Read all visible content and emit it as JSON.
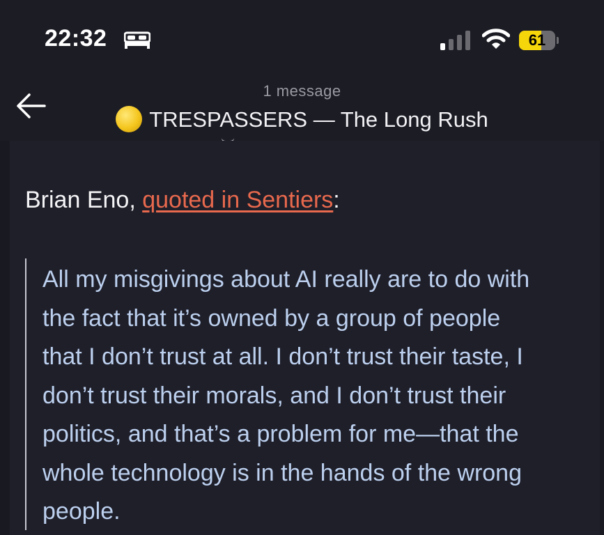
{
  "status_bar": {
    "time": "22:32",
    "battery_percent": "61",
    "battery_level": 0.61,
    "icons": [
      "bed-icon",
      "signal-icon",
      "wifi-icon",
      "battery-icon"
    ]
  },
  "header": {
    "message_count": "1 message",
    "title": "TRESPASSERS — The Long Rush",
    "back_icon": "back-arrow-icon",
    "avatar_icon": "coin-icon"
  },
  "body": {
    "intro_prefix": "Brian Eno, ",
    "intro_link": "quoted in Sentiers",
    "intro_suffix": ":",
    "quote_lines": [
      "All my misgivings about AI really are to do with",
      "the fact that it’s owned by a group of people",
      "that I don’t trust at all. I don’t trust their taste, I",
      "don’t trust their morals, and I don’t trust their",
      "politics, and that’s a problem for me—that the",
      "whole technology is in the hands of the wrong",
      "people."
    ]
  },
  "colors": {
    "background": "#1f1f2a",
    "link": "#e8694d",
    "quote_text": "#bcd0ee",
    "battery": "#f5d60a"
  }
}
